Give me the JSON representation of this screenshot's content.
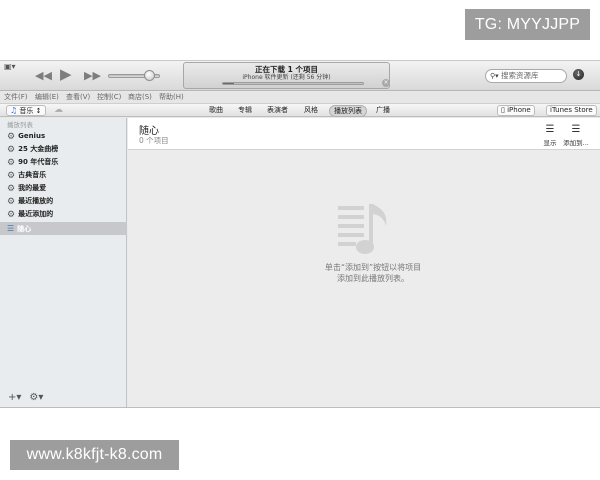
{
  "watermarks": {
    "top": "TG: MYYJJPP",
    "bottom": "www.k8kfjt-k8.com"
  },
  "player": {
    "now_playing_title": "正在下载 1 个项目",
    "now_playing_sub": "iPhone 软件更新 (还剩 56 分钟)",
    "download_progress": 0.08,
    "volume_level": 0.78
  },
  "search": {
    "placeholder": "搜索资源库"
  },
  "menu": [
    "文件(F)",
    "编辑(E)",
    "查看(V)",
    "控制(C)",
    "商店(S)",
    "帮助(H)"
  ],
  "nav": {
    "library": "音乐",
    "tabs": [
      "歌曲",
      "专辑",
      "表演者",
      "风格",
      "播放列表",
      "广播"
    ],
    "iphone_button": "iPhone",
    "store_button": "iTunes Store"
  },
  "sidebar": {
    "header": "播放列表",
    "items": [
      "Genius",
      "25 大金曲榜",
      "90 年代音乐",
      "古典音乐",
      "我的最爱",
      "最近播放的",
      "最近添加的",
      "随心"
    ]
  },
  "main": {
    "title": "随心",
    "count": "0 个项目",
    "show_label": "显示",
    "add_label": "添加到...",
    "empty_line1": "单击“添加到”按钮以将项目",
    "empty_line2": "添加到此播放列表。"
  },
  "colors": {
    "accent_blue": "#4a74b3",
    "selected_row": "#c6c8cc",
    "watermark_bg": "#9d9d9d"
  }
}
